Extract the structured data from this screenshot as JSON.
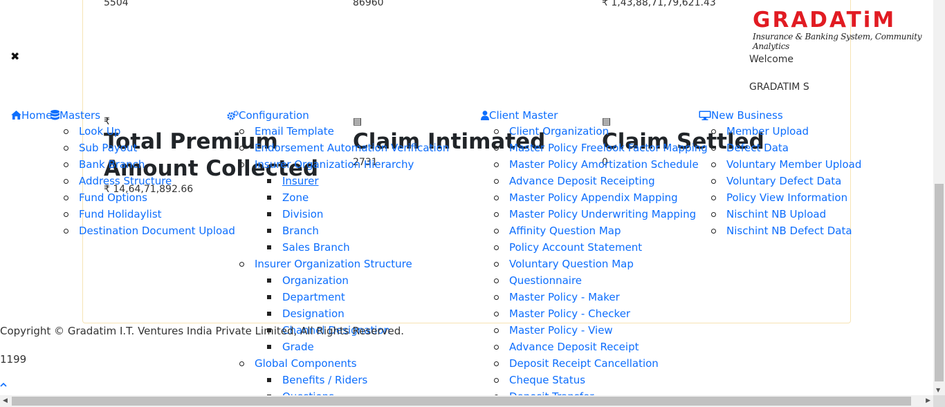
{
  "stats_top": [
    "5504",
    "86960",
    "₹ 1,43,88,71,79,621.43"
  ],
  "cards": [
    {
      "icon": "rupee-icon",
      "icon_glyph": "₹",
      "title_line1": "Total Premium",
      "title_line2": "Amount Collected",
      "value": "₹ 14,64,71,892.66"
    },
    {
      "icon": "document-icon",
      "icon_glyph": "▤",
      "title_line1": "Claim Intimated",
      "title_line2": "",
      "value": "2731"
    },
    {
      "icon": "document-icon",
      "icon_glyph": "▤",
      "title_line1": "Claim Settled",
      "title_line2": "",
      "value": "0"
    }
  ],
  "logo": {
    "name": "GRADATiM",
    "tagline": "Insurance & Banking System, Community Analytics"
  },
  "welcome": "Welcome",
  "username": "GRADATIM S",
  "close_glyph": "✖",
  "nav": {
    "home": "Home",
    "masters": "Masters",
    "configuration": "Configuration",
    "client_master": "Client Master",
    "new_business": "New Business"
  },
  "masters_items": [
    "Look Up",
    "Sub Payout",
    "Bank Branch",
    "Address Structure",
    "Fund Options",
    "Fund Holidaylist",
    "Destination Document Upload"
  ],
  "config_items": [
    {
      "label": "Email Template",
      "level": 1
    },
    {
      "label": "Endorsement Automation Verification",
      "level": 1
    },
    {
      "label": "Insurer Organization Hierarchy",
      "level": 1
    },
    {
      "label": "Insurer",
      "level": 2
    },
    {
      "label": "Zone",
      "level": 2
    },
    {
      "label": "Division",
      "level": 2
    },
    {
      "label": "Branch",
      "level": 2
    },
    {
      "label": "Sales Branch",
      "level": 2
    },
    {
      "label": "Insurer Organization Structure",
      "level": 1
    },
    {
      "label": "Organization",
      "level": 2
    },
    {
      "label": "Department",
      "level": 2
    },
    {
      "label": "Designation",
      "level": 2
    },
    {
      "label": "Channel Designation",
      "level": 2
    },
    {
      "label": "Grade",
      "level": 2
    },
    {
      "label": "Global Components",
      "level": 1
    },
    {
      "label": "Benefits / Riders",
      "level": 2
    },
    {
      "label": "Questions",
      "level": 2
    }
  ],
  "client_items": [
    "Client Organization",
    "Master Policy Freelook Factor Mapping",
    "Master Policy Amortization Schedule",
    "Advance Deposit Receipting",
    "Master Policy Appendix Mapping",
    "Master Policy Underwriting Mapping",
    "Affinity Question Map",
    "Policy Account Statement",
    "Voluntary Question Map",
    "Questionnaire",
    "Master Policy - Maker",
    "Master Policy - Checker",
    "Master Policy - View",
    "Advance Deposit Receipt",
    "Deposit Receipt Cancellation",
    "Cheque Status",
    "Deposit Transfer"
  ],
  "newbiz_items": [
    "Member Upload",
    "Defect Data",
    "Voluntary Member Upload",
    "Voluntary Defect Data",
    "Policy View Information",
    "Nischint NB Upload",
    "Nischint NB Defect Data"
  ],
  "footer": {
    "copyright": "Copyright © Gradatim I.T. Ventures India Private Limited, All Rights Reserved.",
    "number": "1199"
  }
}
